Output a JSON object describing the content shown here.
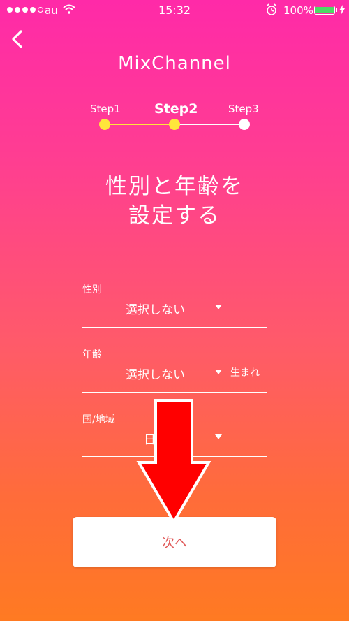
{
  "status_bar": {
    "carrier": "au",
    "time": "15:32",
    "battery_percent": "100%",
    "signal_dots": [
      true,
      true,
      true,
      true,
      false
    ]
  },
  "header": {
    "back_icon": "chevron-left-icon",
    "logo": "MixChannel"
  },
  "steps": {
    "items": [
      {
        "label": "Step1",
        "state": "done"
      },
      {
        "label": "Step2",
        "state": "current"
      },
      {
        "label": "Step3",
        "state": "todo"
      }
    ],
    "done_color": "#ffe63b",
    "todo_color": "#ffffff"
  },
  "title": {
    "line1": "性別と年齢を",
    "line2": "設定する"
  },
  "form": {
    "gender": {
      "label": "性別",
      "value": "選択しない"
    },
    "age": {
      "label": "年齢",
      "value": "選択しない",
      "suffix": "生まれ"
    },
    "region": {
      "label": "国/地域",
      "value": "日"
    }
  },
  "next_button": {
    "label": "次へ",
    "color": "#e05a5a"
  },
  "overlay": {
    "arrow_color": "#ff0000"
  }
}
